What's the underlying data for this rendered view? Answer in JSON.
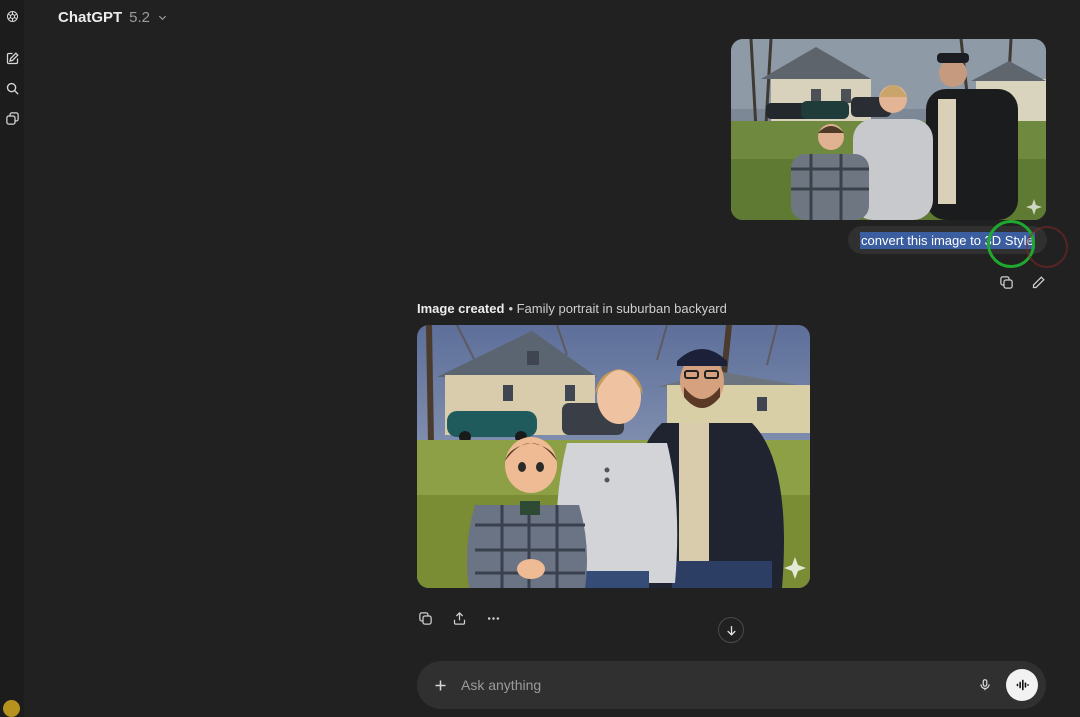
{
  "header": {
    "model_name": "ChatGPT",
    "model_version": "5.2"
  },
  "sidebar": {
    "icons": [
      "logo-icon",
      "new-chat-icon",
      "search-icon",
      "library-icon"
    ]
  },
  "conversation": {
    "user_message": {
      "text": "convert this image to 3D Style",
      "attachment_icon": "sparkle-icon"
    },
    "assistant_message": {
      "caption_strong": "Image created",
      "caption_rest": "• Family portrait in suburban backyard",
      "image_badge_icon": "sparkle-icon"
    }
  },
  "composer": {
    "placeholder": "Ask anything"
  },
  "colors": {
    "background": "#212121",
    "bubble": "#303030",
    "selection": "#3a5ea0",
    "cursor_ring": "#1fa82d"
  }
}
